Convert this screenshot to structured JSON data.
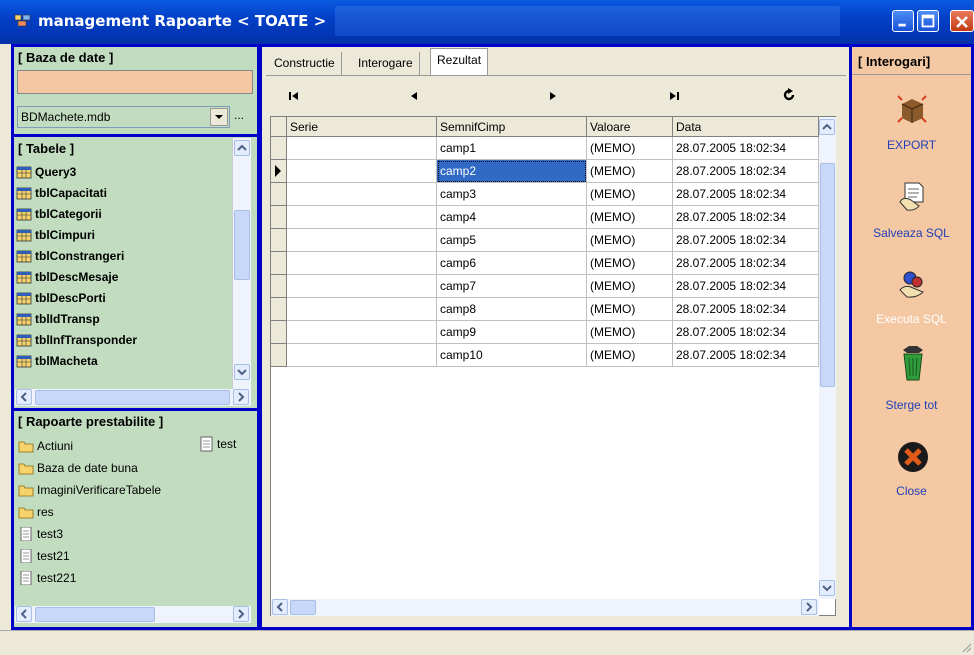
{
  "window": {
    "title": "management Rapoarte < TOATE >"
  },
  "db": {
    "section_title": "[ Baza de date ]",
    "selected_db": "BDMachete.mdb",
    "browse": "..."
  },
  "tables": {
    "section_title": "[ Tabele ]",
    "items": [
      "Query3",
      "tblCapacitati",
      "tblCategorii",
      "tblCimpuri",
      "tblConstrangeri",
      "tblDescMesaje",
      "tblDescPorti",
      "tblIdTransp",
      "tblInfTransponder",
      "tblMacheta"
    ]
  },
  "reports": {
    "section_title": "[ Rapoarte prestabilite ]",
    "items": [
      {
        "name": "Actiuni",
        "type": "folder"
      },
      {
        "name": "Baza de date buna",
        "type": "folder"
      },
      {
        "name": "ImaginiVerificareTabele",
        "type": "folder"
      },
      {
        "name": "res",
        "type": "folder"
      },
      {
        "name": "test3",
        "type": "file"
      },
      {
        "name": "test21",
        "type": "file"
      },
      {
        "name": "test221",
        "type": "file"
      }
    ],
    "side_item": "test"
  },
  "tabs": [
    "Constructie",
    "Interogare",
    "Rezultat"
  ],
  "grid": {
    "columns": [
      "Serie",
      "SemnifCimp",
      "Valoare",
      "Data"
    ],
    "rows": [
      {
        "serie": "",
        "semnif": "camp1",
        "valoare": "(MEMO)",
        "data": "28.07.2005 18:02:34"
      },
      {
        "serie": "",
        "semnif": "camp2",
        "valoare": "(MEMO)",
        "data": "28.07.2005 18:02:34"
      },
      {
        "serie": "",
        "semnif": "camp3",
        "valoare": "(MEMO)",
        "data": "28.07.2005 18:02:34"
      },
      {
        "serie": "",
        "semnif": "camp4",
        "valoare": "(MEMO)",
        "data": "28.07.2005 18:02:34"
      },
      {
        "serie": "",
        "semnif": "camp5",
        "valoare": "(MEMO)",
        "data": "28.07.2005 18:02:34"
      },
      {
        "serie": "",
        "semnif": "camp6",
        "valoare": "(MEMO)",
        "data": "28.07.2005 18:02:34"
      },
      {
        "serie": "",
        "semnif": "camp7",
        "valoare": "(MEMO)",
        "data": "28.07.2005 18:02:34"
      },
      {
        "serie": "",
        "semnif": "camp8",
        "valoare": "(MEMO)",
        "data": "28.07.2005 18:02:34"
      },
      {
        "serie": "",
        "semnif": "camp9",
        "valoare": "(MEMO)",
        "data": "28.07.2005 18:02:34"
      },
      {
        "serie": "",
        "semnif": "camp10",
        "valoare": "(MEMO)",
        "data": "28.07.2005 18:02:34"
      }
    ],
    "selected_row": 1
  },
  "nav": {
    "first": "|◀",
    "prev": "◀",
    "next": "▶",
    "last": "▶|",
    "refresh": "↻"
  },
  "interogari": {
    "section_title": "[ Interogari]",
    "actions": [
      {
        "label": "EXPORT",
        "icon": "box-export-icon",
        "color": "#1F3FB8"
      },
      {
        "label": "Salveaza SQL",
        "icon": "save-sql-icon",
        "color": "#1F3FB8"
      },
      {
        "label": "Executa SQL",
        "icon": "execute-sql-icon",
        "color": "#FFFFFF"
      },
      {
        "label": "Sterge tot",
        "icon": "trash-icon",
        "color": "#1F3FB8"
      },
      {
        "label": "Close",
        "icon": "close-x-icon",
        "color": "#1F3FB8"
      }
    ]
  },
  "colors": {
    "left_panel": "#C1DCBF",
    "right_panel": "#F3C8A3",
    "frame": "#0000C8",
    "selection": "#316AC5"
  }
}
